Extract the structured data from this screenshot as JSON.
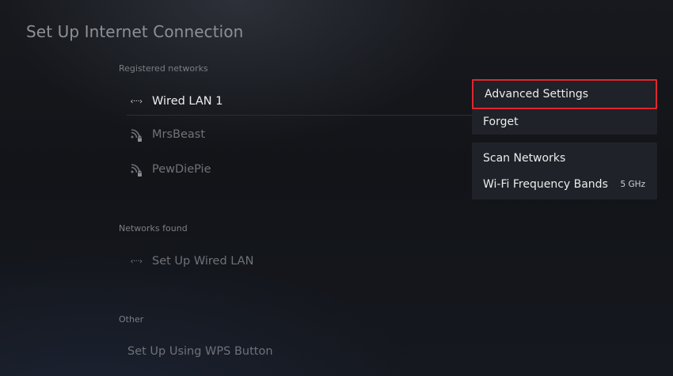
{
  "page": {
    "title": "Set Up Internet Connection"
  },
  "sections": {
    "registered_label": "Registered networks",
    "found_label": "Networks found",
    "other_label": "Other"
  },
  "registered_networks": [
    {
      "name": "Wired LAN 1",
      "icon": "ethernet-icon",
      "locked": false
    },
    {
      "name": "MrsBeast",
      "icon": "wifi-icon",
      "locked": true
    },
    {
      "name": "PewDiePie",
      "icon": "wifi-icon",
      "locked": true
    }
  ],
  "networks_found": [
    {
      "name": "Set Up Wired LAN",
      "icon": "ethernet-icon"
    }
  ],
  "other": [
    {
      "name": "Set Up Using WPS Button"
    }
  ],
  "options_menu": {
    "group1": [
      {
        "label": "Advanced Settings",
        "highlighted": true
      },
      {
        "label": "Forget"
      }
    ],
    "group2": [
      {
        "label": "Scan Networks"
      },
      {
        "label": "Wi-Fi Frequency Bands",
        "value": "5 GHz"
      }
    ]
  },
  "colors": {
    "highlight_border": "#e0262f",
    "menu_background": "#1f2228"
  }
}
